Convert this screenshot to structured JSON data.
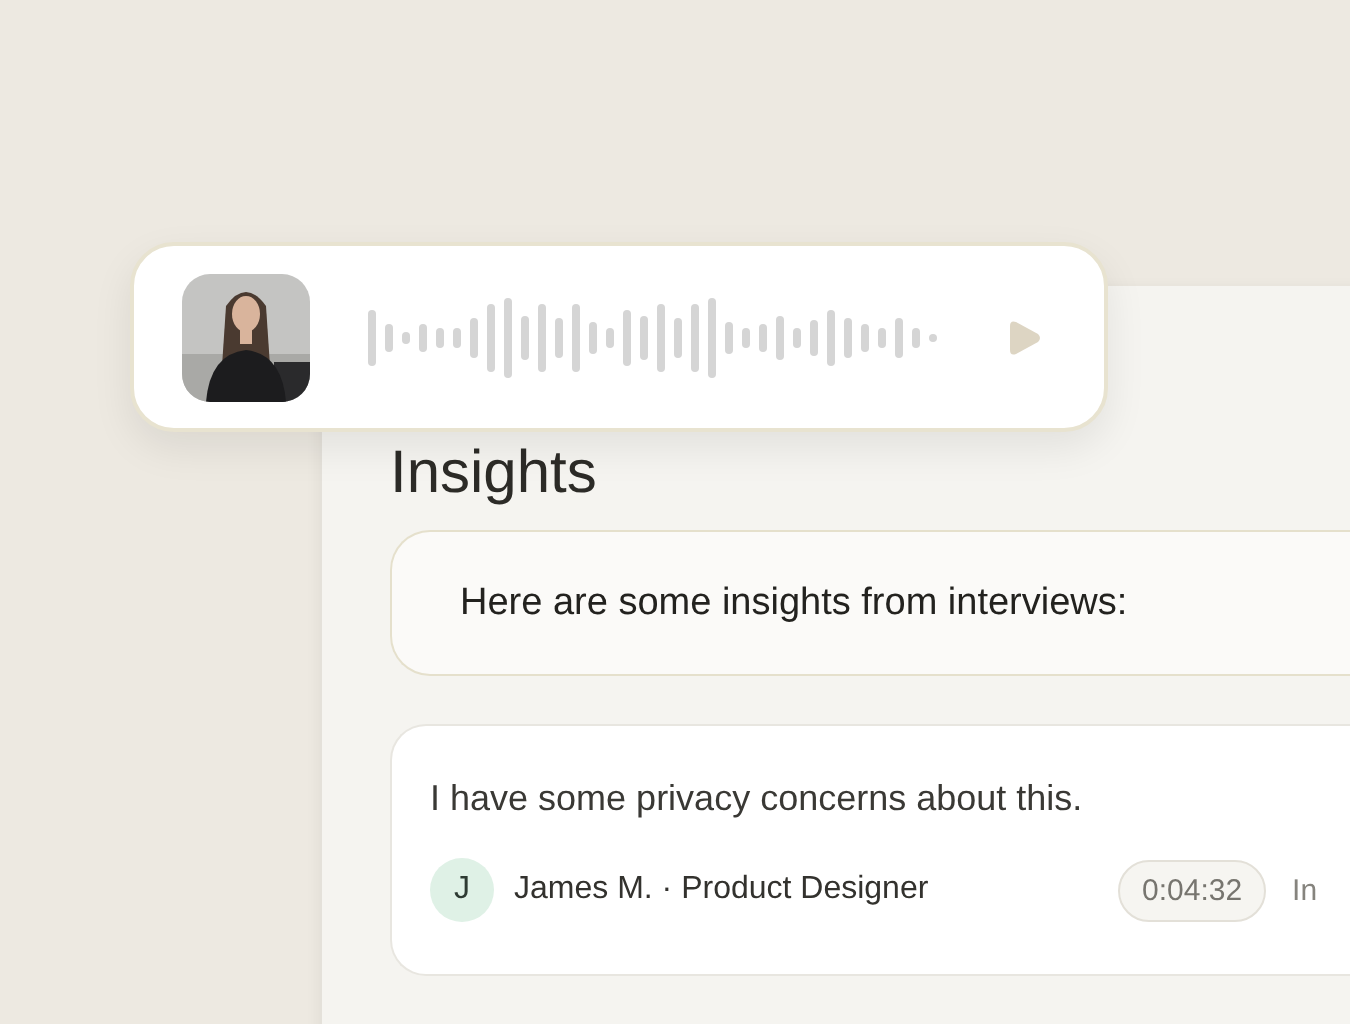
{
  "panel": {
    "title": "Insights",
    "intro": "Here are some insights from interviews:",
    "quotes": [
      {
        "text": "I have some privacy concerns about this.",
        "initial": "J",
        "speaker": "James M. · Product Designer",
        "timestamp": "0:04:32",
        "column_4": "In"
      }
    ]
  }
}
